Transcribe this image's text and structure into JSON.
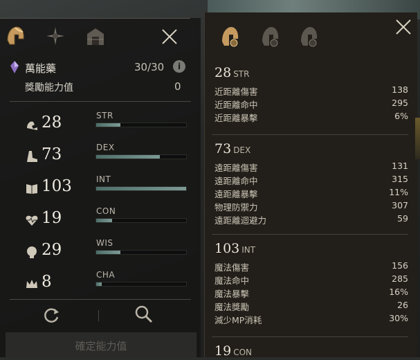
{
  "left_panel": {
    "tabs": [
      {
        "icon": "helmet-icon",
        "active": true
      },
      {
        "icon": "compass-star-icon",
        "active": false
      },
      {
        "icon": "castle-gate-icon",
        "active": false
      }
    ],
    "potion": {
      "name": "萬能藥",
      "count": "30/30",
      "info_glyph": "i"
    },
    "bonus": {
      "label": "獎勵能力值",
      "value": "0"
    },
    "stats": [
      {
        "code": "STR",
        "value": "28",
        "fill": 0.27,
        "icon": "flexed-arm-icon"
      },
      {
        "code": "DEX",
        "value": "73",
        "fill": 0.71,
        "icon": "boot-icon"
      },
      {
        "code": "INT",
        "value": "103",
        "fill": 1.0,
        "icon": "book-icon"
      },
      {
        "code": "CON",
        "value": "19",
        "fill": 0.18,
        "icon": "heartbeat-icon"
      },
      {
        "code": "WIS",
        "value": "29",
        "fill": 0.27,
        "icon": "brain-head-icon"
      },
      {
        "code": "CHA",
        "value": "8",
        "fill": 0.06,
        "icon": "crown-icon"
      }
    ],
    "confirm_label": "確定能力值"
  },
  "right_panel": {
    "tabs": [
      {
        "icon": "helmet-gear-icon",
        "active": true
      },
      {
        "icon": "helmet-shield-icon",
        "active": false
      },
      {
        "icon": "helmet-swirl-icon",
        "active": false
      }
    ],
    "sections": [
      {
        "value": "28",
        "code": "STR",
        "lines": [
          {
            "label": "近距離傷害",
            "value": "138"
          },
          {
            "label": "近距離命中",
            "value": "295"
          },
          {
            "label": "近距離暴擊",
            "value": "6%"
          }
        ]
      },
      {
        "value": "73",
        "code": "DEX",
        "lines": [
          {
            "label": "遠距離傷害",
            "value": "131"
          },
          {
            "label": "遠距離命中",
            "value": "315"
          },
          {
            "label": "遠距離暴擊",
            "value": "11%"
          },
          {
            "label": "物理防禦力",
            "value": "307"
          },
          {
            "label": "遠距離迴避力",
            "value": "59"
          }
        ]
      },
      {
        "value": "103",
        "code": "INT",
        "lines": [
          {
            "label": "魔法傷害",
            "value": "156"
          },
          {
            "label": "魔法命中",
            "value": "285"
          },
          {
            "label": "魔法暴擊",
            "value": "16%"
          },
          {
            "label": "魔法獎勵",
            "value": "26"
          },
          {
            "label": "減少MP消耗",
            "value": "30%"
          }
        ]
      },
      {
        "value": "19",
        "code": "CON",
        "lines": []
      }
    ]
  },
  "colors": {
    "accent_gold": "#c9a46a",
    "bar_fill": "#6f8c87",
    "panel_bg": "#221f1a"
  }
}
